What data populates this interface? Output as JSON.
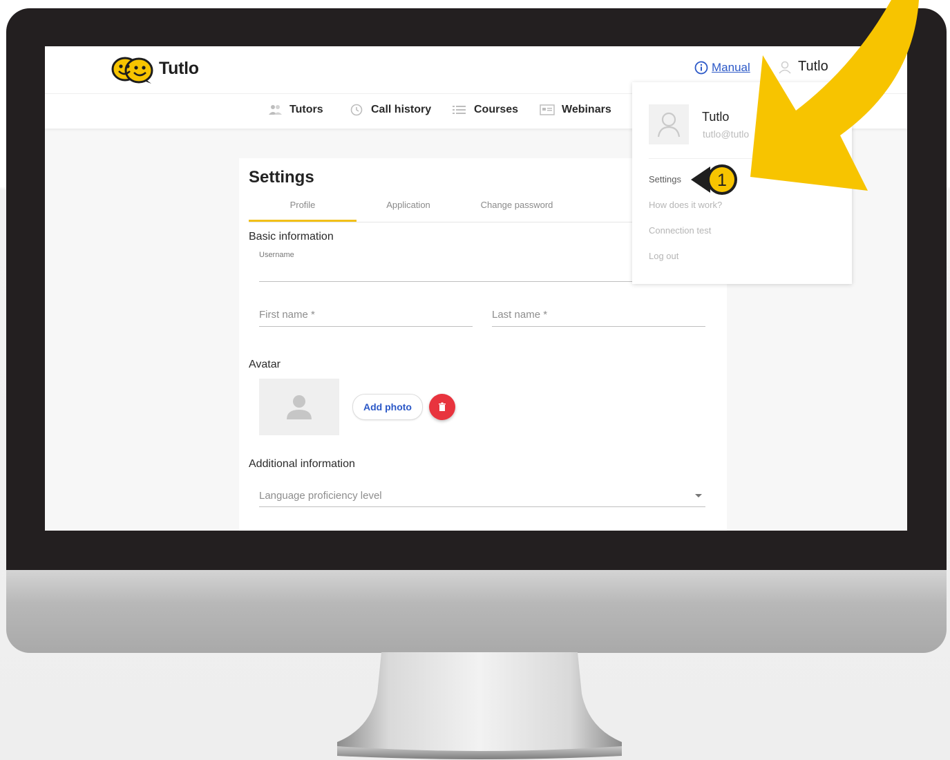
{
  "app": {
    "brand": "Tutlo"
  },
  "header": {
    "manual_label": "Manual",
    "user_label": "Tutlo"
  },
  "nav": {
    "items": [
      {
        "label": "Tutors",
        "icon": "users-icon"
      },
      {
        "label": "Call history",
        "icon": "history-icon"
      },
      {
        "label": "Courses",
        "icon": "list-icon"
      },
      {
        "label": "Webinars",
        "icon": "webinar-icon"
      }
    ]
  },
  "settings": {
    "title": "Settings",
    "tabs": [
      "Profile",
      "Application",
      "Change password"
    ],
    "active_tab": "Profile",
    "basic_info_title": "Basic information",
    "username_label": "Username",
    "first_name_placeholder": "First name *",
    "last_name_placeholder": "Last name *",
    "avatar_title": "Avatar",
    "add_photo_label": "Add photo",
    "additional_info_title": "Additional information",
    "language_level_placeholder": "Language proficiency level"
  },
  "dropdown": {
    "name": "Tutlo",
    "email": "tutlo@tutlo",
    "items": [
      "Settings",
      "How does it work?",
      "Connection test",
      "Log out"
    ]
  },
  "annotation": {
    "step_number": "1"
  },
  "colors": {
    "accent_yellow": "#f7c400",
    "link_blue": "#2b58c7",
    "delete_red": "#e8343e",
    "bezel": "#231f20"
  }
}
